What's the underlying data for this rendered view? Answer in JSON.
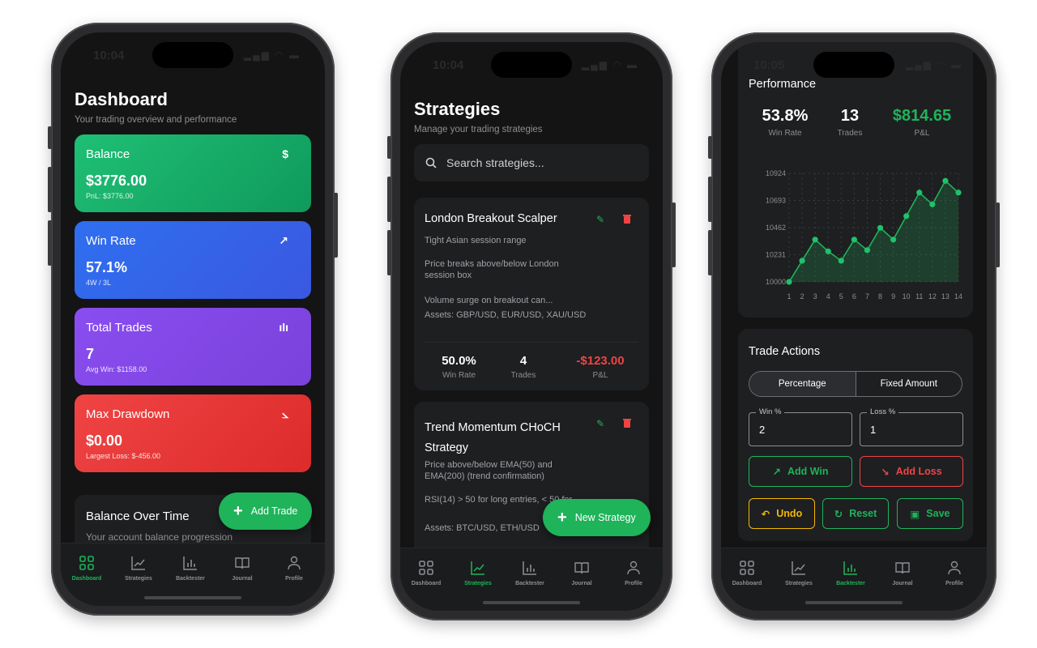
{
  "colors": {
    "accent": "#1fb35a",
    "danger": "#ef4444",
    "warn": "#f5b800",
    "bg": "#141415",
    "panel": "#1e1f21"
  },
  "tabbar": {
    "items": [
      {
        "label": "Dashboard",
        "icon": "dashboard-grid-icon"
      },
      {
        "label": "Strategies",
        "icon": "line-chart-icon"
      },
      {
        "label": "Backtester",
        "icon": "bar-chart-icon"
      },
      {
        "label": "Journal",
        "icon": "book-icon"
      },
      {
        "label": "Profile",
        "icon": "person-icon"
      }
    ]
  },
  "screen1": {
    "time": "10:04",
    "title": "Dashboard",
    "subtitle": "Your trading overview and performance",
    "cards": [
      {
        "label": "Balance",
        "icon": "$",
        "value": "$3776.00",
        "note": "PnL: $3776.00"
      },
      {
        "label": "Win Rate",
        "icon": "↗",
        "value": "57.1%",
        "note": "4W / 3L"
      },
      {
        "label": "Total Trades",
        "icon": "ılı",
        "value": "7",
        "note": "Avg Win: $1158.00"
      },
      {
        "label": "Max Drawdown",
        "icon": "⦣",
        "value": "$0.00",
        "note": "Largest Loss: $-456.00"
      }
    ],
    "balance_panel": {
      "title": "Balance Over Time",
      "subtitle": "Your account balance progression"
    },
    "fab_label": "Add Trade",
    "active_tab": 0
  },
  "screen2": {
    "time": "10:04",
    "title": "Strategies",
    "subtitle": "Manage your trading strategies",
    "search_placeholder": "Search strategies...",
    "strategies": [
      {
        "name": "London Breakout Scalper",
        "lines": [
          "Tight Asian session range",
          "Price breaks above/below London session box",
          "Volume surge on breakout can..."
        ],
        "assets": "Assets: GBP/USD, EUR/USD, XAU/USD",
        "win_rate": "50.0%",
        "win_rate_label": "Win Rate",
        "trades": "4",
        "trades_label": "Trades",
        "pnl": "-$123.00",
        "pnl_label": "P&L"
      },
      {
        "name": "Trend Momentum CHoCH Strategy",
        "lines": [
          "Price above/below EMA(50) and EMA(200) (trend confirmation)",
          "RSI(14) > 50 for long entries, < 50 for..."
        ],
        "assets": "Assets: BTC/USD, ETH/USD"
      }
    ],
    "fab_label": "New Strategy",
    "active_tab": 1
  },
  "screen3": {
    "time": "10:05",
    "performance": {
      "title": "Performance",
      "win_rate": "53.8%",
      "win_rate_label": "Win Rate",
      "trades": "13",
      "trades_label": "Trades",
      "pnl": "$814.65",
      "pnl_label": "P&L"
    },
    "chart_data": {
      "type": "area",
      "x": [
        1,
        2,
        3,
        4,
        5,
        6,
        7,
        8,
        9,
        10,
        11,
        12,
        13,
        14
      ],
      "values": [
        10000,
        10180,
        10360,
        10260,
        10180,
        10360,
        10270,
        10460,
        10360,
        10560,
        10760,
        10660,
        10860,
        10760
      ],
      "y_ticks": [
        10000,
        10231,
        10462,
        10693,
        10924
      ],
      "ylim": [
        10000,
        10924
      ],
      "grid": true
    },
    "actions": {
      "title": "Trade Actions",
      "modes": [
        "Percentage",
        "Fixed Amount"
      ],
      "win_label": "Win %",
      "win_value": "2",
      "loss_label": "Loss %",
      "loss_value": "1",
      "add_win": "Add Win",
      "add_loss": "Add Loss",
      "undo": "Undo",
      "reset": "Reset",
      "save": "Save"
    },
    "active_tab": 2
  }
}
